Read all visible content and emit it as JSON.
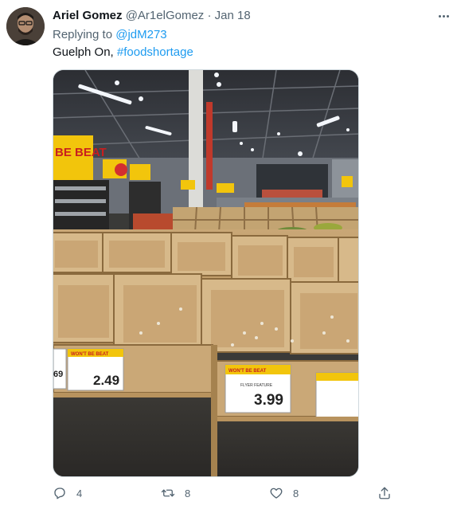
{
  "tweet": {
    "author_name": "Ariel Gomez",
    "author_handle": "@Ar1elGomez",
    "separator": "·",
    "date": "Jan 18",
    "replying_prefix": "Replying to",
    "replying_to": "@jdM273",
    "text_plain": "Guelph On, ",
    "hashtag": "#foodshortage"
  },
  "media": {
    "store_sign": "BE BEAT",
    "price_left": "2.49",
    "price_left_partial": "69",
    "price_right": "3.99",
    "price_tag_header": "WON'T BE BEAT",
    "price_tag_sub": "FLYER FEATURE"
  },
  "actions": {
    "reply_count": "4",
    "retweet_count": "8",
    "like_count": "8"
  },
  "icons": {
    "more": "more-horizontal-icon",
    "reply": "reply-icon",
    "retweet": "retweet-icon",
    "like": "heart-icon",
    "share": "share-icon"
  },
  "colors": {
    "link": "#1d9bf0",
    "muted": "#536471",
    "text": "#0f1419"
  }
}
